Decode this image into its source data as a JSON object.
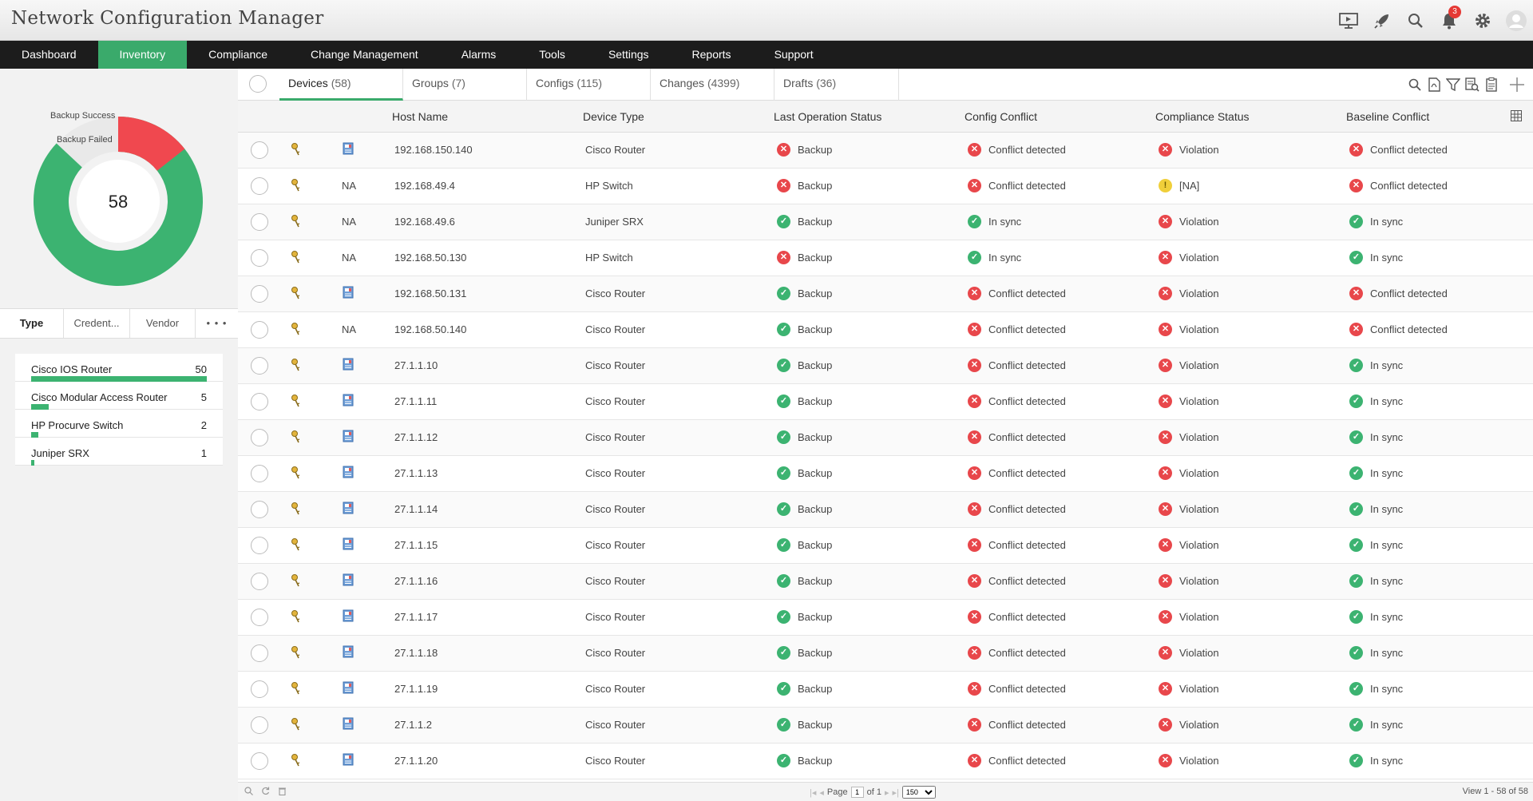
{
  "app": {
    "title": "Network Configuration Manager",
    "notifications": "3"
  },
  "top_icons": [
    "presentation-icon",
    "rocket-icon",
    "search-icon",
    "bell-icon",
    "gear-icon",
    "user-avatar-icon"
  ],
  "nav": {
    "items": [
      "Dashboard",
      "Inventory",
      "Compliance",
      "Change Management",
      "Alarms",
      "Tools",
      "Settings",
      "Reports",
      "Support"
    ],
    "active": "Inventory"
  },
  "donut": {
    "center": "58",
    "legend_success": "Backup Success",
    "legend_failed": "Backup Failed",
    "success_count": 52,
    "failed_count": 6,
    "colors": {
      "success": "#3cb371",
      "failed": "#f0484f"
    }
  },
  "filter_tabs": [
    "Type",
    "Credent...",
    "Vendor",
    "• • •"
  ],
  "type_list": [
    {
      "name": "Cisco IOS Router",
      "count": "50",
      "fraction": 1.0
    },
    {
      "name": "Cisco Modular Access Router",
      "count": "5",
      "fraction": 0.1
    },
    {
      "name": "HP Procurve Switch",
      "count": "2",
      "fraction": 0.04
    },
    {
      "name": "Juniper SRX",
      "count": "1",
      "fraction": 0.02
    }
  ],
  "tabs": [
    {
      "label": "Devices",
      "count": "(58)"
    },
    {
      "label": "Groups",
      "count": "(7)"
    },
    {
      "label": "Configs",
      "count": "(115)"
    },
    {
      "label": "Changes",
      "count": "(4399)"
    },
    {
      "label": "Drafts",
      "count": "(36)"
    }
  ],
  "columns": [
    "Host Name",
    "Device Type",
    "Last Operation Status",
    "Config Conflict",
    "Compliance Status",
    "Baseline Conflict"
  ],
  "rows": [
    {
      "na": "",
      "host": "192.168.150.140",
      "type": "Cisco Router",
      "op": [
        "err",
        "Backup"
      ],
      "cc": [
        "err",
        "Conflict detected"
      ],
      "comp": [
        "err",
        "Violation"
      ],
      "base": [
        "err",
        "Conflict detected"
      ]
    },
    {
      "na": "NA",
      "host": "192.168.49.4",
      "type": "HP Switch",
      "op": [
        "err",
        "Backup"
      ],
      "cc": [
        "err",
        "Conflict detected"
      ],
      "comp": [
        "warn",
        "[NA]"
      ],
      "base": [
        "err",
        "Conflict detected"
      ]
    },
    {
      "na": "NA",
      "host": "192.168.49.6",
      "type": "Juniper SRX",
      "op": [
        "ok",
        "Backup"
      ],
      "cc": [
        "ok",
        "In sync"
      ],
      "comp": [
        "err",
        "Violation"
      ],
      "base": [
        "ok",
        "In sync"
      ]
    },
    {
      "na": "NA",
      "host": "192.168.50.130",
      "type": "HP Switch",
      "op": [
        "err",
        "Backup"
      ],
      "cc": [
        "ok",
        "In sync"
      ],
      "comp": [
        "err",
        "Violation"
      ],
      "base": [
        "ok",
        "In sync"
      ]
    },
    {
      "na": "",
      "host": "192.168.50.131",
      "type": "Cisco Router",
      "op": [
        "ok",
        "Backup"
      ],
      "cc": [
        "err",
        "Conflict detected"
      ],
      "comp": [
        "err",
        "Violation"
      ],
      "base": [
        "err",
        "Conflict detected"
      ]
    },
    {
      "na": "NA",
      "host": "192.168.50.140",
      "type": "Cisco Router",
      "op": [
        "ok",
        "Backup"
      ],
      "cc": [
        "err",
        "Conflict detected"
      ],
      "comp": [
        "err",
        "Violation"
      ],
      "base": [
        "err",
        "Conflict detected"
      ]
    },
    {
      "na": "",
      "host": "27.1.1.10",
      "type": "Cisco Router",
      "op": [
        "ok",
        "Backup"
      ],
      "cc": [
        "err",
        "Conflict detected"
      ],
      "comp": [
        "err",
        "Violation"
      ],
      "base": [
        "ok",
        "In sync"
      ]
    },
    {
      "na": "",
      "host": "27.1.1.11",
      "type": "Cisco Router",
      "op": [
        "ok",
        "Backup"
      ],
      "cc": [
        "err",
        "Conflict detected"
      ],
      "comp": [
        "err",
        "Violation"
      ],
      "base": [
        "ok",
        "In sync"
      ]
    },
    {
      "na": "",
      "host": "27.1.1.12",
      "type": "Cisco Router",
      "op": [
        "ok",
        "Backup"
      ],
      "cc": [
        "err",
        "Conflict detected"
      ],
      "comp": [
        "err",
        "Violation"
      ],
      "base": [
        "ok",
        "In sync"
      ]
    },
    {
      "na": "",
      "host": "27.1.1.13",
      "type": "Cisco Router",
      "op": [
        "ok",
        "Backup"
      ],
      "cc": [
        "err",
        "Conflict detected"
      ],
      "comp": [
        "err",
        "Violation"
      ],
      "base": [
        "ok",
        "In sync"
      ]
    },
    {
      "na": "",
      "host": "27.1.1.14",
      "type": "Cisco Router",
      "op": [
        "ok",
        "Backup"
      ],
      "cc": [
        "err",
        "Conflict detected"
      ],
      "comp": [
        "err",
        "Violation"
      ],
      "base": [
        "ok",
        "In sync"
      ]
    },
    {
      "na": "",
      "host": "27.1.1.15",
      "type": "Cisco Router",
      "op": [
        "ok",
        "Backup"
      ],
      "cc": [
        "err",
        "Conflict detected"
      ],
      "comp": [
        "err",
        "Violation"
      ],
      "base": [
        "ok",
        "In sync"
      ]
    },
    {
      "na": "",
      "host": "27.1.1.16",
      "type": "Cisco Router",
      "op": [
        "ok",
        "Backup"
      ],
      "cc": [
        "err",
        "Conflict detected"
      ],
      "comp": [
        "err",
        "Violation"
      ],
      "base": [
        "ok",
        "In sync"
      ]
    },
    {
      "na": "",
      "host": "27.1.1.17",
      "type": "Cisco Router",
      "op": [
        "ok",
        "Backup"
      ],
      "cc": [
        "err",
        "Conflict detected"
      ],
      "comp": [
        "err",
        "Violation"
      ],
      "base": [
        "ok",
        "In sync"
      ]
    },
    {
      "na": "",
      "host": "27.1.1.18",
      "type": "Cisco Router",
      "op": [
        "ok",
        "Backup"
      ],
      "cc": [
        "err",
        "Conflict detected"
      ],
      "comp": [
        "err",
        "Violation"
      ],
      "base": [
        "ok",
        "In sync"
      ]
    },
    {
      "na": "",
      "host": "27.1.1.19",
      "type": "Cisco Router",
      "op": [
        "ok",
        "Backup"
      ],
      "cc": [
        "err",
        "Conflict detected"
      ],
      "comp": [
        "err",
        "Violation"
      ],
      "base": [
        "ok",
        "In sync"
      ]
    },
    {
      "na": "",
      "host": "27.1.1.2",
      "type": "Cisco Router",
      "op": [
        "ok",
        "Backup"
      ],
      "cc": [
        "err",
        "Conflict detected"
      ],
      "comp": [
        "err",
        "Violation"
      ],
      "base": [
        "ok",
        "In sync"
      ]
    },
    {
      "na": "",
      "host": "27.1.1.20",
      "type": "Cisco Router",
      "op": [
        "ok",
        "Backup"
      ],
      "cc": [
        "err",
        "Conflict detected"
      ],
      "comp": [
        "err",
        "Violation"
      ],
      "base": [
        "ok",
        "In sync"
      ]
    }
  ],
  "footer": {
    "page_label": "Page",
    "page_value": "1",
    "of_label": "of 1",
    "page_size": "150",
    "view_info": "View 1 - 58 of 58"
  }
}
